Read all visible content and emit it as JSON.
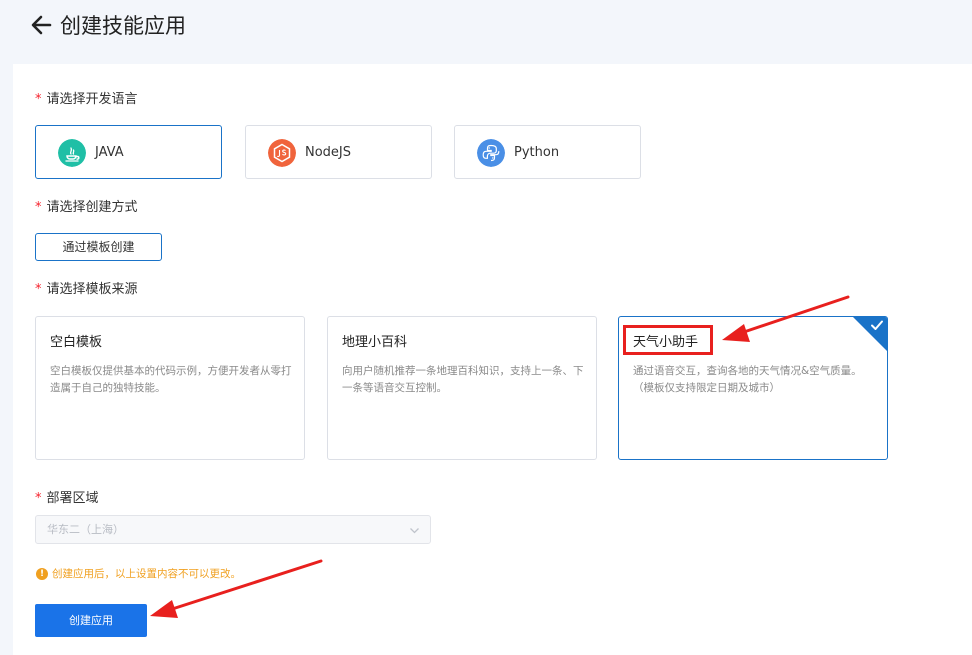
{
  "header": {
    "title": "创建技能应用"
  },
  "form": {
    "language": {
      "label": "请选择开发语言",
      "options": [
        {
          "label": "JAVA",
          "icon": "java-icon",
          "color": "#1fbfa6",
          "selected": true
        },
        {
          "label": "NodeJS",
          "icon": "nodejs-icon",
          "color": "#f0643c",
          "selected": false
        },
        {
          "label": "Python",
          "icon": "python-icon",
          "color": "#4a8fe6",
          "selected": false
        }
      ]
    },
    "method": {
      "label": "请选择创建方式",
      "button": "通过模板创建"
    },
    "template": {
      "label": "请选择模板来源",
      "cards": [
        {
          "title": "空白模板",
          "desc": "空白模板仅提供基本的代码示例，方便开发者从零打造属于自己的独特技能。",
          "selected": false
        },
        {
          "title": "地理小百科",
          "desc": "向用户随机推荐一条地理百科知识，支持上一条、下一条等语音交互控制。",
          "selected": false
        },
        {
          "title": "天气小助手",
          "desc": "通过语音交互，查询各地的天气情况&空气质量。（模板仅支持限定日期及城市）",
          "selected": true
        }
      ]
    },
    "region": {
      "label": "部署区域",
      "value": "华东二（上海）"
    },
    "warning": "创建应用后，以上设置内容不可以更改。",
    "submit": "创建应用"
  },
  "colors": {
    "accent": "#1a73e8",
    "required": "#f5222d",
    "warning": "#f0a020",
    "annotation": "#e8201e"
  }
}
